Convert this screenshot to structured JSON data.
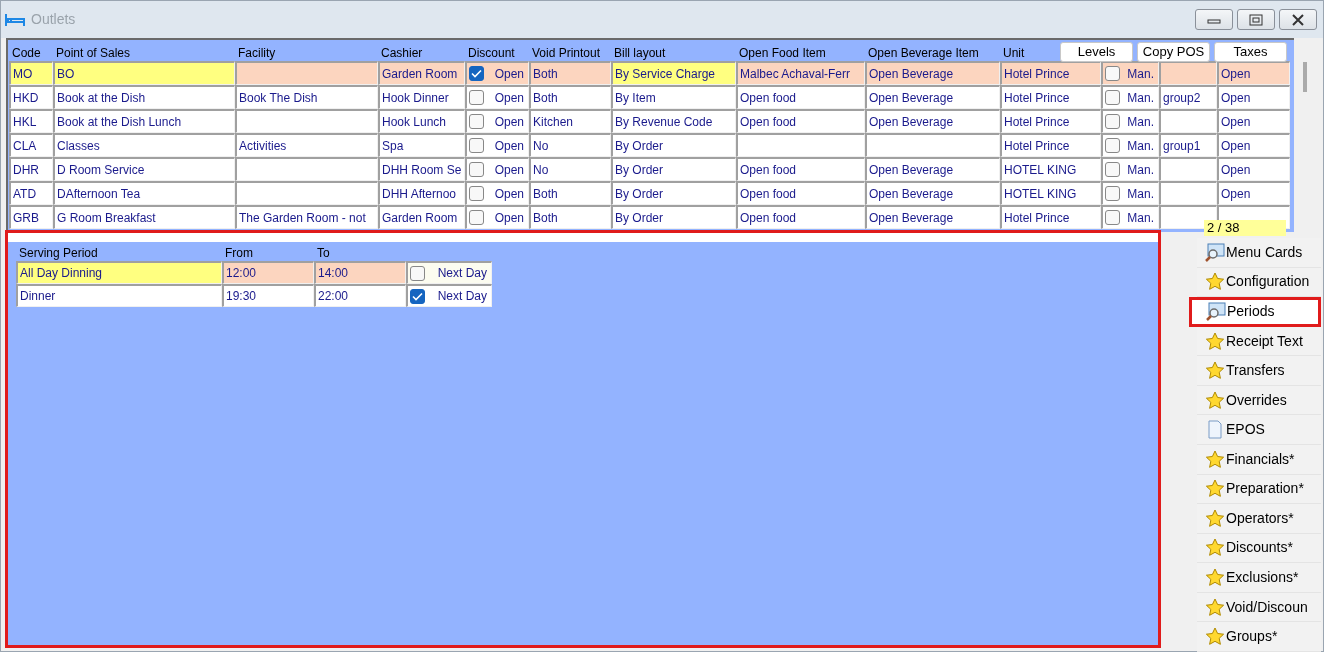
{
  "window": {
    "title": "Outlets",
    "buttons": [
      {
        "kind": "minimize"
      },
      {
        "kind": "restore"
      },
      {
        "kind": "close"
      }
    ]
  },
  "outlets": {
    "columns": [
      "Code",
      "Point of Sales",
      "Facility",
      "Cashier",
      "Discount",
      "Void Printout",
      "Bill layout",
      "Open Food Item",
      "Open Beverage Item",
      "Unit"
    ],
    "buttons": [
      "Levels",
      "Copy POS",
      "Taxes"
    ],
    "rows": [
      {
        "selected": true,
        "cells": [
          {
            "kind": "text",
            "text": "MO"
          },
          {
            "kind": "text",
            "text": "BO"
          },
          {
            "kind": "text",
            "text": ""
          },
          {
            "kind": "text",
            "text": "Garden Room"
          },
          {
            "kind": "check",
            "checked": true,
            "text": "Open"
          },
          {
            "kind": "text",
            "text": "Both"
          },
          {
            "kind": "text",
            "text": "By Service Charge"
          },
          {
            "kind": "text",
            "text": "Malbec Achaval-Ferr"
          },
          {
            "kind": "text",
            "text": "Open Beverage"
          },
          {
            "kind": "text",
            "text": "Hotel Prince"
          },
          {
            "kind": "check",
            "checked": false,
            "text": "Man."
          },
          {
            "kind": "text",
            "text": ""
          },
          {
            "kind": "text",
            "text": "Open"
          }
        ]
      },
      {
        "selected": false,
        "cells": [
          {
            "kind": "text",
            "text": "HKD"
          },
          {
            "kind": "text",
            "text": "Book at the Dish"
          },
          {
            "kind": "text",
            "text": "Book The Dish"
          },
          {
            "kind": "text",
            "text": "Hook Dinner"
          },
          {
            "kind": "check",
            "checked": false,
            "text": "Open"
          },
          {
            "kind": "text",
            "text": "Both"
          },
          {
            "kind": "text",
            "text": "By Item"
          },
          {
            "kind": "text",
            "text": "Open food"
          },
          {
            "kind": "text",
            "text": "Open Beverage"
          },
          {
            "kind": "text",
            "text": "Hotel Prince"
          },
          {
            "kind": "check",
            "checked": false,
            "text": "Man."
          },
          {
            "kind": "text",
            "text": "group2"
          },
          {
            "kind": "text",
            "text": "Open"
          }
        ]
      },
      {
        "selected": false,
        "cells": [
          {
            "kind": "text",
            "text": "HKL"
          },
          {
            "kind": "text",
            "text": "Book at the Dish Lunch"
          },
          {
            "kind": "text",
            "text": ""
          },
          {
            "kind": "text",
            "text": "Hook Lunch"
          },
          {
            "kind": "check",
            "checked": false,
            "text": "Open"
          },
          {
            "kind": "text",
            "text": "Kitchen"
          },
          {
            "kind": "text",
            "text": "By Revenue Code"
          },
          {
            "kind": "text",
            "text": "Open food"
          },
          {
            "kind": "text",
            "text": "Open Beverage"
          },
          {
            "kind": "text",
            "text": "Hotel Prince"
          },
          {
            "kind": "check",
            "checked": false,
            "text": "Man."
          },
          {
            "kind": "text",
            "text": ""
          },
          {
            "kind": "text",
            "text": "Open"
          }
        ]
      },
      {
        "selected": false,
        "cells": [
          {
            "kind": "text",
            "text": "CLA"
          },
          {
            "kind": "text",
            "text": "Classes"
          },
          {
            "kind": "text",
            "text": "Activities"
          },
          {
            "kind": "text",
            "text": "Spa"
          },
          {
            "kind": "check",
            "checked": false,
            "text": "Open"
          },
          {
            "kind": "text",
            "text": "No"
          },
          {
            "kind": "text",
            "text": "By Order"
          },
          {
            "kind": "text",
            "text": ""
          },
          {
            "kind": "text",
            "text": ""
          },
          {
            "kind": "text",
            "text": "Hotel Prince"
          },
          {
            "kind": "check",
            "checked": false,
            "text": "Man."
          },
          {
            "kind": "text",
            "text": "group1"
          },
          {
            "kind": "text",
            "text": "Open"
          }
        ]
      },
      {
        "selected": false,
        "cells": [
          {
            "kind": "text",
            "text": "DHR"
          },
          {
            "kind": "text",
            "text": "D Room Service"
          },
          {
            "kind": "text",
            "text": ""
          },
          {
            "kind": "text",
            "text": "DHH Room Se"
          },
          {
            "kind": "check",
            "checked": false,
            "text": "Open"
          },
          {
            "kind": "text",
            "text": "No"
          },
          {
            "kind": "text",
            "text": "By Order"
          },
          {
            "kind": "text",
            "text": "Open food"
          },
          {
            "kind": "text",
            "text": "Open Beverage"
          },
          {
            "kind": "text",
            "text": "HOTEL KING"
          },
          {
            "kind": "check",
            "checked": false,
            "text": "Man."
          },
          {
            "kind": "text",
            "text": ""
          },
          {
            "kind": "text",
            "text": "Open"
          }
        ]
      },
      {
        "selected": false,
        "cells": [
          {
            "kind": "text",
            "text": "ATD"
          },
          {
            "kind": "text",
            "text": "DAfternoon Tea"
          },
          {
            "kind": "text",
            "text": ""
          },
          {
            "kind": "text",
            "text": "DHH Afternoo"
          },
          {
            "kind": "check",
            "checked": false,
            "text": "Open"
          },
          {
            "kind": "text",
            "text": "Both"
          },
          {
            "kind": "text",
            "text": "By Order"
          },
          {
            "kind": "text",
            "text": "Open food"
          },
          {
            "kind": "text",
            "text": "Open Beverage"
          },
          {
            "kind": "text",
            "text": "HOTEL KING"
          },
          {
            "kind": "check",
            "checked": false,
            "text": "Man."
          },
          {
            "kind": "text",
            "text": ""
          },
          {
            "kind": "text",
            "text": "Open"
          }
        ]
      },
      {
        "selected": false,
        "cells": [
          {
            "kind": "text",
            "text": "GRB"
          },
          {
            "kind": "text",
            "text": "G Room Breakfast"
          },
          {
            "kind": "text",
            "text": "The Garden Room - not"
          },
          {
            "kind": "text",
            "text": "Garden Room"
          },
          {
            "kind": "check",
            "checked": false,
            "text": "Open"
          },
          {
            "kind": "text",
            "text": "Both"
          },
          {
            "kind": "text",
            "text": "By Order"
          },
          {
            "kind": "text",
            "text": "Open food"
          },
          {
            "kind": "text",
            "text": "Open Beverage"
          },
          {
            "kind": "text",
            "text": "Hotel Prince"
          },
          {
            "kind": "check",
            "checked": false,
            "text": "Man."
          },
          {
            "kind": "text",
            "text": ""
          },
          {
            "kind": "text",
            "text": ""
          }
        ]
      }
    ],
    "record_counter": "2 / 38"
  },
  "periods": {
    "outlined": true,
    "columns": [
      "Serving Period",
      "From",
      "To"
    ],
    "rows": [
      {
        "selected": true,
        "cells": [
          {
            "kind": "text",
            "text": "All Day Dinning"
          },
          {
            "kind": "text",
            "text": "12:00"
          },
          {
            "kind": "text",
            "text": "14:00"
          },
          {
            "kind": "check",
            "checked": false,
            "text": "Next Day"
          }
        ]
      },
      {
        "selected": false,
        "cells": [
          {
            "kind": "text",
            "text": "Dinner"
          },
          {
            "kind": "text",
            "text": "19:30"
          },
          {
            "kind": "text",
            "text": "22:00"
          },
          {
            "kind": "check",
            "checked": true,
            "text": "Next Day"
          }
        ]
      }
    ]
  },
  "side_menu": [
    {
      "label": "Menu Cards",
      "selected": false
    },
    {
      "label": "Configuration",
      "selected": false
    },
    {
      "label": "Periods",
      "selected": true
    },
    {
      "label": "Receipt Text",
      "selected": false
    },
    {
      "label": "Transfers",
      "selected": false
    },
    {
      "label": "Overrides",
      "selected": false
    },
    {
      "label": "EPOS",
      "selected": false
    },
    {
      "label": "Financials*",
      "selected": false
    },
    {
      "label": "Preparation*",
      "selected": false
    },
    {
      "label": "Operators*",
      "selected": false
    },
    {
      "label": "Discounts*",
      "selected": false
    },
    {
      "label": "Exclusions*",
      "selected": false
    },
    {
      "label": "Void/Discoun",
      "selected": false
    },
    {
      "label": "Groups*",
      "selected": false
    }
  ]
}
